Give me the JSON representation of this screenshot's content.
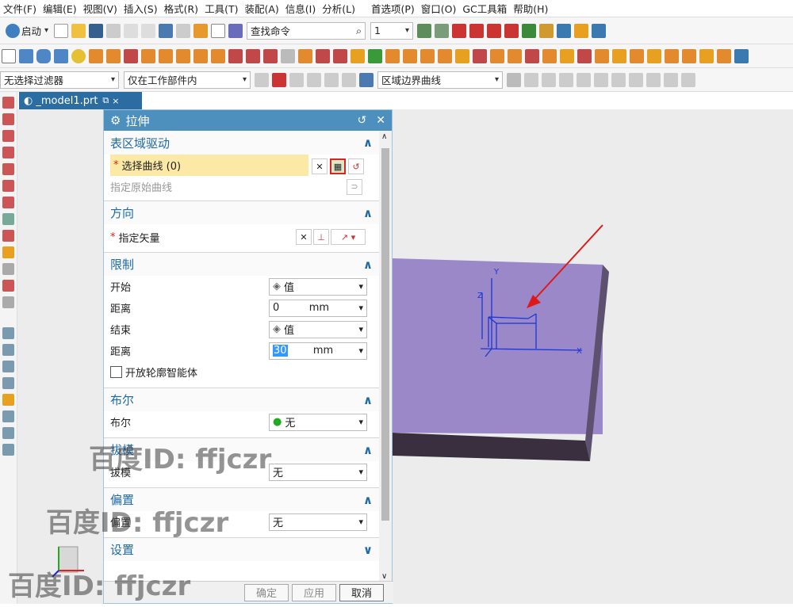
{
  "menubar": {
    "items": [
      "文件(F)",
      "编辑(E)",
      "视图(V)",
      "插入(S)",
      "格式(R)",
      "工具(T)",
      "装配(A)",
      "信息(I)",
      "分析(L)",
      "首选项(P)",
      "窗口(O)",
      "GC工具箱",
      "帮助(H)"
    ]
  },
  "toolbar1": {
    "start_label": "启动",
    "search_placeholder": "查找命令",
    "count_value": "1"
  },
  "toolbar3": {
    "filter_label": "无选择过滤器",
    "scope_label": "仅在工作部件内",
    "curve_rule_label": "区域边界曲线"
  },
  "tab": {
    "label": "_model1.prt"
  },
  "dialog": {
    "title": "拉伸",
    "sec_drive": {
      "title": "表区域驱动",
      "select_curve": "选择曲线 (0)",
      "specify_origin": "指定原始曲线"
    },
    "sec_dir": {
      "title": "方向",
      "vector": "指定矢量"
    },
    "sec_limit": {
      "title": "限制",
      "start_label": "开始",
      "start_value": "值",
      "dist1_label": "距离",
      "dist1_value": "0",
      "dist1_unit": "mm",
      "end_label": "结束",
      "end_value": "值",
      "dist2_label": "距离",
      "dist2_value": "30",
      "dist2_unit": "mm",
      "open_profile": "开放轮廓智能体"
    },
    "sec_bool": {
      "title": "布尔",
      "label": "布尔",
      "value": "无"
    },
    "sec_draft": {
      "title": "拔模",
      "label": "拔模",
      "value": "无"
    },
    "sec_offset": {
      "title": "偏置",
      "label": "偏置",
      "value": "无"
    },
    "sec_settings": {
      "title": "设置"
    },
    "buttons": {
      "ok": "确定",
      "apply": "应用",
      "cancel": "取消"
    }
  },
  "viewport": {
    "axis_x": "X",
    "axis_y": "Y",
    "axis_z": "Z"
  },
  "watermark": {
    "text": "百度ID: ffjczr"
  },
  "colors": {
    "accent": "#4d8fbd",
    "highlight_row": "#fde9a6",
    "plate_top": "#9b88c8",
    "plate_side": "#5e516f",
    "arrow": "#e01818",
    "sketch": "#1a36d6"
  }
}
